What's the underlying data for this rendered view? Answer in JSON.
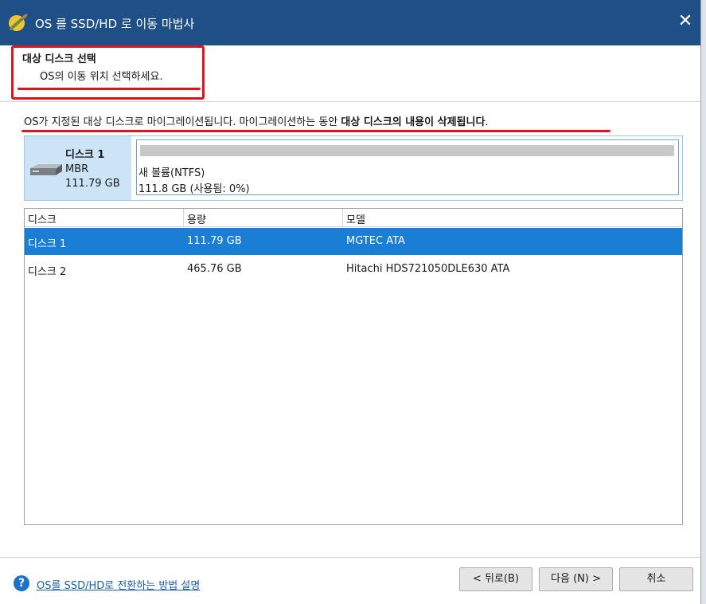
{
  "window": {
    "title": "OS 를 SSD/HD 로 이동 마법사",
    "close_glyph": "✕"
  },
  "header": {
    "title": "대상 디스크 선택",
    "subtitle": "OS의 이동 위치 선택하세요."
  },
  "info": {
    "normal_text": "OS가 지정된 대상 디스크로 마이그레이션됩니다. 마이그레이션하는 동안 ",
    "bold_text": "대상 디스크의 내용이 삭제됩니다",
    "tail": "."
  },
  "disk_map": {
    "name": "디스크 1",
    "style": "MBR",
    "size": "111.79 GB",
    "icon": "hdd-icon",
    "partition": {
      "label": "새 볼륨(NTFS)",
      "info": "111.8 GB (사용됨: 0%)",
      "used_fraction": 0.0
    }
  },
  "table": {
    "columns": [
      "디스크",
      "용량",
      "모델"
    ],
    "rows": [
      {
        "disk": "디스크 1",
        "capacity": "111.79 GB",
        "model": "MGTEC ATA",
        "selected": true
      },
      {
        "disk": "디스크 2",
        "capacity": "465.76 GB",
        "model": "Hitachi HDS721050DLE630 ATA",
        "selected": false
      }
    ]
  },
  "footer": {
    "help_icon_glyph": "?",
    "help_link": "OS를 SSD/HD로 전환하는 방법 설명",
    "back_button": "< 뒤로(B)",
    "next_button": "다음 (N) >",
    "cancel_button": "취소"
  },
  "colors": {
    "titlebar": "#1e4f86",
    "selection": "#1a7fd4",
    "highlight_red": "#e0141d",
    "disk_card": "#cde4f7"
  }
}
